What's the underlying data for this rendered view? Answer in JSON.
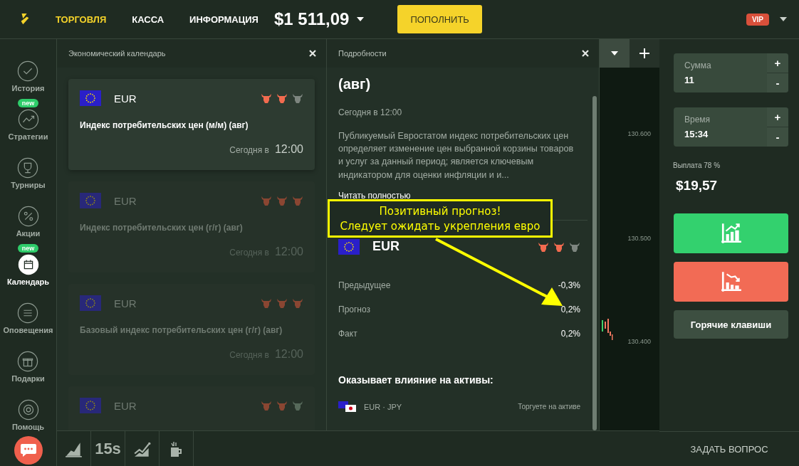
{
  "topbar": {
    "nav": [
      {
        "label": "ТОРГОВЛЯ",
        "selected": true
      },
      {
        "label": "КАССА",
        "selected": false
      },
      {
        "label": "ИНФОРМАЦИЯ",
        "selected": false
      }
    ],
    "balance": "$1 511,09",
    "deposit_button": "ПОПОЛНИТЬ",
    "badge": "VIP"
  },
  "sidebar": {
    "items": [
      {
        "kind": "check",
        "label": "История",
        "selected": false
      },
      {
        "kind": "trend",
        "label": "Стратегии",
        "badge": "new",
        "selected": false
      },
      {
        "kind": "trophy",
        "label": "Турниры",
        "selected": false
      },
      {
        "kind": "percent",
        "label": "Акции",
        "selected": false
      },
      {
        "kind": "calendar",
        "label": "Календарь",
        "badge": "new",
        "selected": true
      },
      {
        "kind": "list",
        "label": "Оповещения",
        "selected": false
      },
      {
        "kind": "gift",
        "label": "Подарки",
        "selected": false
      },
      {
        "kind": "help",
        "label": "Помощь",
        "selected": false
      }
    ]
  },
  "calendar": {
    "title": "Экономический календарь",
    "events": [
      {
        "currency": "EUR",
        "title": "Индекс потребительских цен (м/м) (авг)",
        "time_prefix": "Сегодня в",
        "time": "12:00",
        "selected": true,
        "impact": [
          {
            "on": true
          },
          {
            "on": true
          },
          {
            "on": false
          }
        ]
      },
      {
        "currency": "EUR",
        "title": "Индекс потребительских цен (г/г) (авг)",
        "time_prefix": "Сегодня в",
        "time": "12:00",
        "selected": false,
        "impact": [
          {
            "on": true
          },
          {
            "on": true
          },
          {
            "on": true
          }
        ]
      },
      {
        "currency": "EUR",
        "title": "Базовый индекс потребительских цен (г/г) (авг)",
        "time_prefix": "Сегодня в",
        "time": "12:00",
        "selected": false,
        "impact": [
          {
            "on": true
          },
          {
            "on": true
          },
          {
            "on": true
          }
        ]
      },
      {
        "currency": "EUR",
        "selected": false,
        "impact": [
          {
            "on": true
          },
          {
            "on": true
          },
          {
            "on": false
          }
        ]
      }
    ]
  },
  "details": {
    "title": "Подробности",
    "event_title": "(авг)",
    "time": "Сегодня в 12:00",
    "description": "Публикуемый Евростатом индекс потребительских цен определяет изменение цен выбранной корзины товаров и услуг за данный период; является ключевым индикатором для оценки инфляции и и...",
    "read_more": "Читать полностью",
    "currency": "EUR",
    "impact": [
      {
        "on": true
      },
      {
        "on": true
      },
      {
        "on": false
      }
    ],
    "stats": [
      {
        "label": "Предыдущее",
        "value": "-0,3%"
      },
      {
        "label": "Прогноз",
        "value": "0,2%"
      },
      {
        "label": "Факт",
        "value": "0,2%"
      }
    ],
    "assets_heading": "Оказывает влияние на активы:",
    "assets": [
      {
        "pair": "EUR · JPY",
        "note": "Торгуете на активе"
      }
    ]
  },
  "chart": {
    "price_labels": [
      "130.600",
      "130.500",
      "130.400"
    ]
  },
  "bottom_bar": {
    "timeframe": "15s"
  },
  "trade": {
    "fields": [
      {
        "label": "Сумма",
        "value": "11",
        "plus": "+",
        "minus": "-"
      },
      {
        "label": "Время",
        "value": "15:34",
        "plus": "+",
        "minus": "-"
      }
    ],
    "payout_label": "Выплата 78 %",
    "payout": "$19,57",
    "hotkeys": "Горячие клавиши",
    "ask": "ЗАДАТЬ ВОПРОС"
  },
  "annotation": {
    "lines": [
      "Позитивный прогноз!",
      "Следует ожидать укрепления евро"
    ]
  }
}
